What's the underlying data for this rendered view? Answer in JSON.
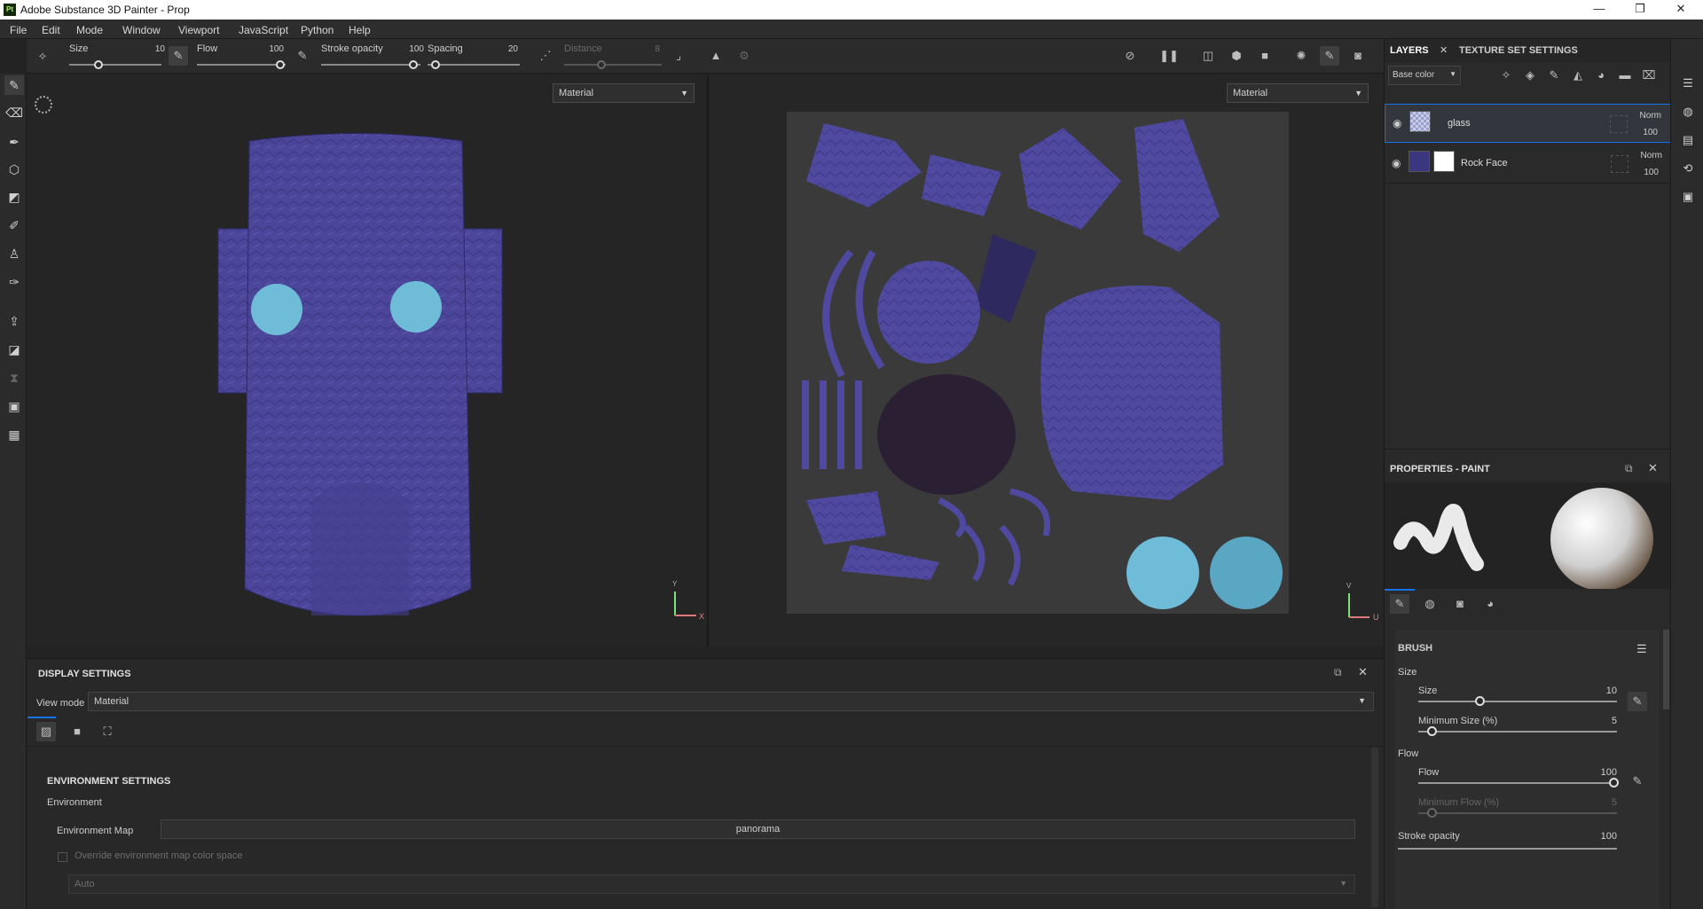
{
  "app": {
    "title": "Adobe Substance 3D Painter - Prop",
    "logo": "Pt"
  },
  "window_controls": [
    "—",
    "❐",
    "✕"
  ],
  "menu": [
    "File",
    "Edit",
    "Mode",
    "Window",
    "Viewport",
    "JavaScript",
    "Python",
    "Help"
  ],
  "tool_options": {
    "size_label": "Size",
    "size_value": "10",
    "flow_label": "Flow",
    "flow_value": "100",
    "stroke_opacity_label": "Stroke opacity",
    "stroke_opacity_value": "100",
    "spacing_label": "Spacing",
    "spacing_value": "20",
    "distance_label": "Distance",
    "distance_value": "8"
  },
  "viewport3d": {
    "mode": "Material",
    "axis_y": "Y",
    "axis_x": "X"
  },
  "viewport2d": {
    "mode": "Material",
    "axis_v": "V",
    "axis_u": "U"
  },
  "display_settings": {
    "title": "DISPLAY SETTINGS",
    "view_mode_label": "View mode",
    "view_mode_value": "Material",
    "env_section": "ENVIRONMENT SETTINGS",
    "env_label": "Environment",
    "env_map_label": "Environment Map",
    "env_map_value": "panorama",
    "override_label": "Override environment map color space",
    "auto_value": "Auto"
  },
  "layers": {
    "tab_layers": "LAYERS",
    "tab_texture": "TEXTURE SET SETTINGS",
    "channel": "Base color",
    "items": [
      {
        "name": "glass",
        "blend": "Norm",
        "opacity": "100"
      },
      {
        "name": "Rock Face",
        "blend": "Norm",
        "opacity": "100"
      }
    ]
  },
  "properties": {
    "title": "PROPERTIES - PAINT",
    "brush_section": "BRUSH",
    "size_group": "Size",
    "size_label": "Size",
    "size_value": "10",
    "min_size_label": "Minimum Size (%)",
    "min_size_value": "5",
    "flow_group": "Flow",
    "flow_label": "Flow",
    "flow_value": "100",
    "min_flow_label": "Minimum Flow (%)",
    "min_flow_value": "5",
    "stroke_opacity_label": "Stroke opacity",
    "stroke_opacity_value": "100"
  },
  "colors": {
    "accent": "#1473e6",
    "material": "#4c469a",
    "glass": "#6fbcd8"
  }
}
